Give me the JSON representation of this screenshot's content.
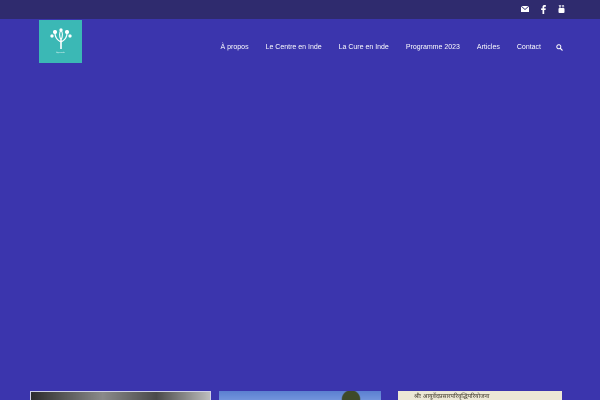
{
  "site": {
    "logo_text": "Ayurveda",
    "brand_color": "#3bb8b5",
    "background_color": "#3b35ad"
  },
  "topbar": {
    "icons": [
      "envelope-icon",
      "facebook-icon",
      "youtube-icon"
    ]
  },
  "nav": {
    "items": [
      {
        "label": "À propos"
      },
      {
        "label": "Le Centre en Inde"
      },
      {
        "label": "La Cure en Inde"
      },
      {
        "label": "Programme 2023"
      },
      {
        "label": "Articles"
      },
      {
        "label": "Contact"
      }
    ],
    "search_icon": "search-icon"
  },
  "thumbnails": {
    "third_caption": "श्रीः आयुर्वेदप्रसारपरिवृद्धिपरियोजना"
  }
}
